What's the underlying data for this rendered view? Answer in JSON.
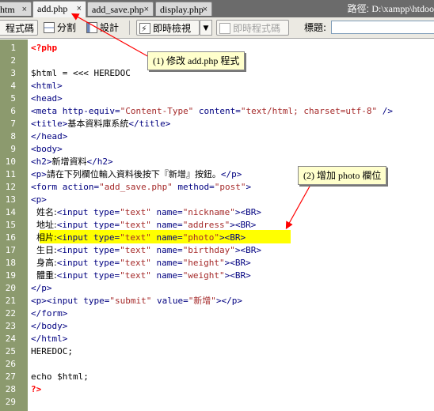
{
  "tabs": [
    {
      "label": "htm",
      "active": false
    },
    {
      "label": "add.php",
      "active": true
    },
    {
      "label": "add_save.php",
      "active": false
    },
    {
      "label": "display.php",
      "active": false
    }
  ],
  "close_glyph": "×",
  "path": {
    "label": "路徑:",
    "value": "D:\\xampp\\htdoo"
  },
  "toolbar": {
    "code_view": "程式碼",
    "split_view": "分割",
    "design_view": "設計",
    "live_view": "即時檢視",
    "dropdown_arrow": "▼",
    "live_code": "即時程式碼",
    "title_label": "標題:",
    "title_value": ""
  },
  "code_lines": [
    {
      "n": "1",
      "parts": [
        [
          "php",
          "<?php"
        ]
      ]
    },
    {
      "n": "2",
      "parts": []
    },
    {
      "n": "3",
      "parts": [
        [
          "plain",
          "$html = <<< HEREDOC"
        ]
      ]
    },
    {
      "n": "4",
      "parts": [
        [
          "tag",
          "<html>"
        ]
      ]
    },
    {
      "n": "5",
      "parts": [
        [
          "tag",
          "<head>"
        ]
      ]
    },
    {
      "n": "6",
      "parts": [
        [
          "tag",
          "<meta http-equiv="
        ],
        [
          "str",
          "\"Content-Type\""
        ],
        [
          "tag",
          " content="
        ],
        [
          "str",
          "\"text/html; charset=utf-8\""
        ],
        [
          "tag",
          " />"
        ]
      ]
    },
    {
      "n": "7",
      "parts": [
        [
          "tag",
          "<title>"
        ],
        [
          "cjk",
          "基本資料庫系統"
        ],
        [
          "tag",
          "</title>"
        ]
      ]
    },
    {
      "n": "8",
      "parts": [
        [
          "tag",
          "</head>"
        ]
      ]
    },
    {
      "n": "9",
      "parts": [
        [
          "tag",
          "<body>"
        ]
      ]
    },
    {
      "n": "10",
      "parts": [
        [
          "tag",
          "<h2>"
        ],
        [
          "cjk",
          "新增資料"
        ],
        [
          "tag",
          "</h2>"
        ]
      ]
    },
    {
      "n": "11",
      "parts": [
        [
          "tag",
          "<p>"
        ],
        [
          "cjk",
          "請在下列欄位輸入資料後按下『新增』按鈕。"
        ],
        [
          "tag",
          "</p>"
        ]
      ]
    },
    {
      "n": "12",
      "parts": [
        [
          "tag",
          "<form action="
        ],
        [
          "str",
          "\"add_save.php\""
        ],
        [
          "tag",
          " method="
        ],
        [
          "str",
          "\"post\""
        ],
        [
          "tag",
          ">"
        ]
      ]
    },
    {
      "n": "13",
      "parts": [
        [
          "tag",
          "<p>"
        ]
      ]
    },
    {
      "n": "14",
      "parts": [
        [
          "cjk",
          "  姓名:"
        ],
        [
          "tag",
          "<input type="
        ],
        [
          "str",
          "\"text\""
        ],
        [
          "tag",
          " name="
        ],
        [
          "str",
          "\"nickname\""
        ],
        [
          "tag",
          "><BR>"
        ]
      ]
    },
    {
      "n": "15",
      "parts": [
        [
          "cjk",
          "  地址:"
        ],
        [
          "tag",
          "<input type="
        ],
        [
          "str",
          "\"text\""
        ],
        [
          "tag",
          " name="
        ],
        [
          "str",
          "\"address\""
        ],
        [
          "tag",
          "><BR>"
        ]
      ]
    },
    {
      "n": "16",
      "parts": [
        [
          "cjk",
          "  相片:"
        ],
        [
          "tag",
          "<input type="
        ],
        [
          "str",
          "\"text\""
        ],
        [
          "tag",
          " name="
        ],
        [
          "str",
          "\"photo\""
        ],
        [
          "tag",
          "><BR>"
        ]
      ]
    },
    {
      "n": "17",
      "parts": [
        [
          "cjk",
          "  生日:"
        ],
        [
          "tag",
          "<input type="
        ],
        [
          "str",
          "\"text\""
        ],
        [
          "tag",
          " name="
        ],
        [
          "str",
          "\"birthday\""
        ],
        [
          "tag",
          "><BR>"
        ]
      ]
    },
    {
      "n": "18",
      "parts": [
        [
          "cjk",
          "  身高:"
        ],
        [
          "tag",
          "<input type="
        ],
        [
          "str",
          "\"text\""
        ],
        [
          "tag",
          " name="
        ],
        [
          "str",
          "\"height\""
        ],
        [
          "tag",
          "><BR>"
        ]
      ]
    },
    {
      "n": "19",
      "parts": [
        [
          "cjk",
          "  體重:"
        ],
        [
          "tag",
          "<input type="
        ],
        [
          "str",
          "\"text\""
        ],
        [
          "tag",
          " name="
        ],
        [
          "str",
          "\"weight\""
        ],
        [
          "tag",
          "><BR>"
        ]
      ]
    },
    {
      "n": "20",
      "parts": [
        [
          "tag",
          "</p>"
        ]
      ]
    },
    {
      "n": "21",
      "parts": [
        [
          "tag",
          "<p><input type="
        ],
        [
          "str",
          "\"submit\""
        ],
        [
          "tag",
          " value="
        ],
        [
          "str",
          "\"新增\""
        ],
        [
          "tag",
          "></p>"
        ]
      ]
    },
    {
      "n": "22",
      "parts": [
        [
          "tag",
          "</form>"
        ]
      ]
    },
    {
      "n": "23",
      "parts": [
        [
          "tag",
          "</body>"
        ]
      ]
    },
    {
      "n": "24",
      "parts": [
        [
          "tag",
          "</html>"
        ]
      ]
    },
    {
      "n": "25",
      "parts": [
        [
          "plain",
          "HEREDOC;"
        ]
      ]
    },
    {
      "n": "26",
      "parts": []
    },
    {
      "n": "27",
      "parts": [
        [
          "plain",
          "echo $html;"
        ]
      ]
    },
    {
      "n": "28",
      "parts": [
        [
          "php",
          "?>"
        ]
      ]
    },
    {
      "n": "29",
      "parts": []
    }
  ],
  "highlighted_line": "16",
  "annotations": {
    "note1": "(1) 修改 add.php 程式",
    "note2": "(2) 增加 photo 欄位"
  },
  "colors": {
    "gutter": "#8c9a6e",
    "highlight": "#ffff00",
    "tag": "#000080",
    "string": "#a52a2a",
    "php": "#ff0000",
    "arrow": "#ff0000"
  }
}
